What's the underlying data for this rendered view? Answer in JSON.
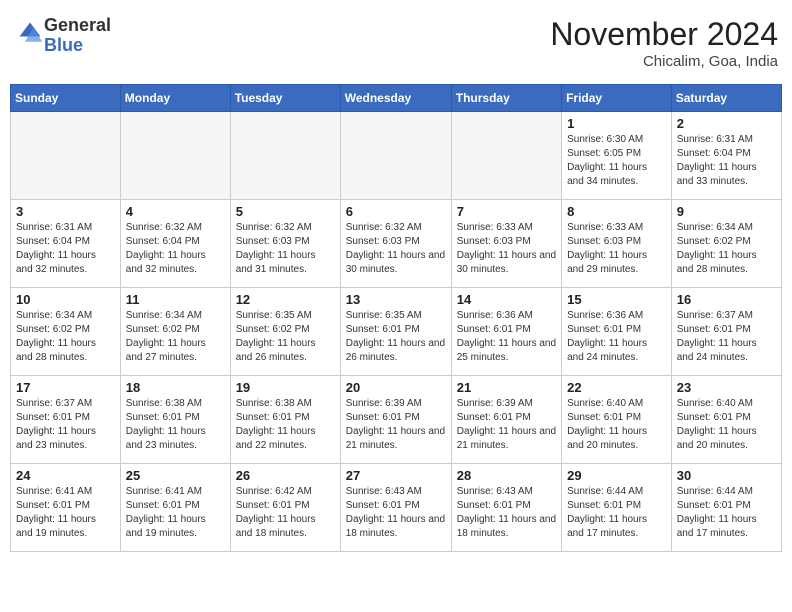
{
  "header": {
    "logo_general": "General",
    "logo_blue": "Blue",
    "month_title": "November 2024",
    "location": "Chicalim, Goa, India"
  },
  "weekdays": [
    "Sunday",
    "Monday",
    "Tuesday",
    "Wednesday",
    "Thursday",
    "Friday",
    "Saturday"
  ],
  "weeks": [
    [
      {
        "day": "",
        "info": ""
      },
      {
        "day": "",
        "info": ""
      },
      {
        "day": "",
        "info": ""
      },
      {
        "day": "",
        "info": ""
      },
      {
        "day": "",
        "info": ""
      },
      {
        "day": "1",
        "info": "Sunrise: 6:30 AM\nSunset: 6:05 PM\nDaylight: 11 hours and 34 minutes."
      },
      {
        "day": "2",
        "info": "Sunrise: 6:31 AM\nSunset: 6:04 PM\nDaylight: 11 hours and 33 minutes."
      }
    ],
    [
      {
        "day": "3",
        "info": "Sunrise: 6:31 AM\nSunset: 6:04 PM\nDaylight: 11 hours and 32 minutes."
      },
      {
        "day": "4",
        "info": "Sunrise: 6:32 AM\nSunset: 6:04 PM\nDaylight: 11 hours and 32 minutes."
      },
      {
        "day": "5",
        "info": "Sunrise: 6:32 AM\nSunset: 6:03 PM\nDaylight: 11 hours and 31 minutes."
      },
      {
        "day": "6",
        "info": "Sunrise: 6:32 AM\nSunset: 6:03 PM\nDaylight: 11 hours and 30 minutes."
      },
      {
        "day": "7",
        "info": "Sunrise: 6:33 AM\nSunset: 6:03 PM\nDaylight: 11 hours and 30 minutes."
      },
      {
        "day": "8",
        "info": "Sunrise: 6:33 AM\nSunset: 6:03 PM\nDaylight: 11 hours and 29 minutes."
      },
      {
        "day": "9",
        "info": "Sunrise: 6:34 AM\nSunset: 6:02 PM\nDaylight: 11 hours and 28 minutes."
      }
    ],
    [
      {
        "day": "10",
        "info": "Sunrise: 6:34 AM\nSunset: 6:02 PM\nDaylight: 11 hours and 28 minutes."
      },
      {
        "day": "11",
        "info": "Sunrise: 6:34 AM\nSunset: 6:02 PM\nDaylight: 11 hours and 27 minutes."
      },
      {
        "day": "12",
        "info": "Sunrise: 6:35 AM\nSunset: 6:02 PM\nDaylight: 11 hours and 26 minutes."
      },
      {
        "day": "13",
        "info": "Sunrise: 6:35 AM\nSunset: 6:01 PM\nDaylight: 11 hours and 26 minutes."
      },
      {
        "day": "14",
        "info": "Sunrise: 6:36 AM\nSunset: 6:01 PM\nDaylight: 11 hours and 25 minutes."
      },
      {
        "day": "15",
        "info": "Sunrise: 6:36 AM\nSunset: 6:01 PM\nDaylight: 11 hours and 24 minutes."
      },
      {
        "day": "16",
        "info": "Sunrise: 6:37 AM\nSunset: 6:01 PM\nDaylight: 11 hours and 24 minutes."
      }
    ],
    [
      {
        "day": "17",
        "info": "Sunrise: 6:37 AM\nSunset: 6:01 PM\nDaylight: 11 hours and 23 minutes."
      },
      {
        "day": "18",
        "info": "Sunrise: 6:38 AM\nSunset: 6:01 PM\nDaylight: 11 hours and 23 minutes."
      },
      {
        "day": "19",
        "info": "Sunrise: 6:38 AM\nSunset: 6:01 PM\nDaylight: 11 hours and 22 minutes."
      },
      {
        "day": "20",
        "info": "Sunrise: 6:39 AM\nSunset: 6:01 PM\nDaylight: 11 hours and 21 minutes."
      },
      {
        "day": "21",
        "info": "Sunrise: 6:39 AM\nSunset: 6:01 PM\nDaylight: 11 hours and 21 minutes."
      },
      {
        "day": "22",
        "info": "Sunrise: 6:40 AM\nSunset: 6:01 PM\nDaylight: 11 hours and 20 minutes."
      },
      {
        "day": "23",
        "info": "Sunrise: 6:40 AM\nSunset: 6:01 PM\nDaylight: 11 hours and 20 minutes."
      }
    ],
    [
      {
        "day": "24",
        "info": "Sunrise: 6:41 AM\nSunset: 6:01 PM\nDaylight: 11 hours and 19 minutes."
      },
      {
        "day": "25",
        "info": "Sunrise: 6:41 AM\nSunset: 6:01 PM\nDaylight: 11 hours and 19 minutes."
      },
      {
        "day": "26",
        "info": "Sunrise: 6:42 AM\nSunset: 6:01 PM\nDaylight: 11 hours and 18 minutes."
      },
      {
        "day": "27",
        "info": "Sunrise: 6:43 AM\nSunset: 6:01 PM\nDaylight: 11 hours and 18 minutes."
      },
      {
        "day": "28",
        "info": "Sunrise: 6:43 AM\nSunset: 6:01 PM\nDaylight: 11 hours and 18 minutes."
      },
      {
        "day": "29",
        "info": "Sunrise: 6:44 AM\nSunset: 6:01 PM\nDaylight: 11 hours and 17 minutes."
      },
      {
        "day": "30",
        "info": "Sunrise: 6:44 AM\nSunset: 6:01 PM\nDaylight: 11 hours and 17 minutes."
      }
    ]
  ]
}
